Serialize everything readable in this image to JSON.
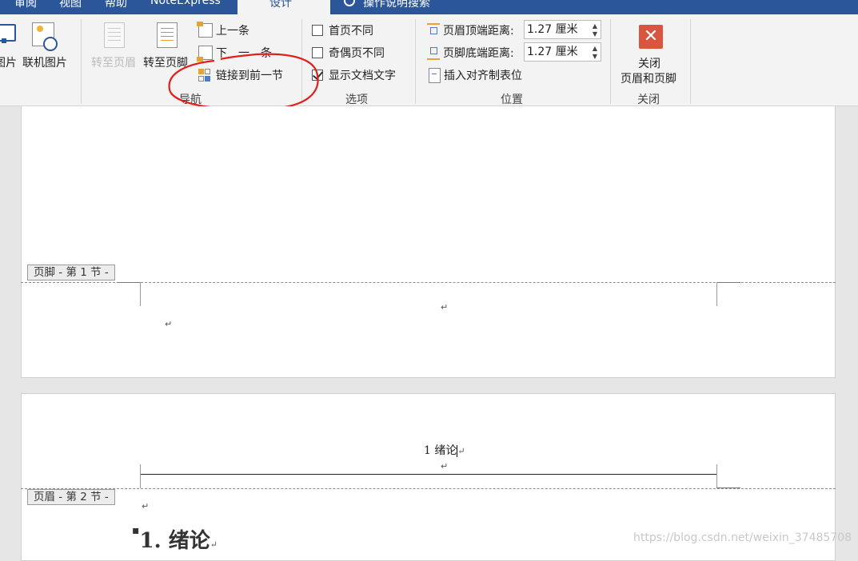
{
  "tabs": {
    "review": "审阅",
    "view": "视图",
    "help": "帮助",
    "noteexpress": "NoteExpress",
    "design": "设计",
    "tell_me": "操作说明搜索"
  },
  "insert_group": {
    "picture_label": "图片",
    "online_picture_label": "联机图片"
  },
  "navigation_group": {
    "goto_header_label": "转至页眉",
    "goto_footer_label": "转至页脚",
    "previous_label": "上一条",
    "next_label": "下一条",
    "link_to_previous_label": "链接到前一节",
    "group_label": "导航"
  },
  "options_group": {
    "different_first_page": {
      "label": "首页不同",
      "checked": false
    },
    "different_odd_even": {
      "label": "奇偶页不同",
      "checked": false
    },
    "show_document_text": {
      "label": "显示文档文字",
      "checked": true
    },
    "group_label": "选项"
  },
  "position_group": {
    "header_from_top_label": "页眉顶端距离:",
    "header_from_top_value": "1.27 厘米",
    "footer_from_bottom_label": "页脚底端距离:",
    "footer_from_bottom_value": "1.27 厘米",
    "insert_alignment_tab_label": "插入对齐制表位",
    "group_label": "位置"
  },
  "close_group": {
    "close_label_line1": "关闭",
    "close_label_line2": "页眉和页脚",
    "group_label": "关闭"
  },
  "document": {
    "footer_tag_section1": "页脚 - 第 1 节 -",
    "header_tag_section2": "页眉 - 第 2 节 -",
    "header_text_section2": "1 绪论",
    "paragraph_mark": "↵",
    "heading_text": "1.  绪论"
  },
  "watermark": "https://blog.csdn.net/weixin_37485708",
  "colors": {
    "ribbon_accent": "#2b579a",
    "close_button": "#d9553f",
    "annotation_circle": "#e0201c"
  }
}
